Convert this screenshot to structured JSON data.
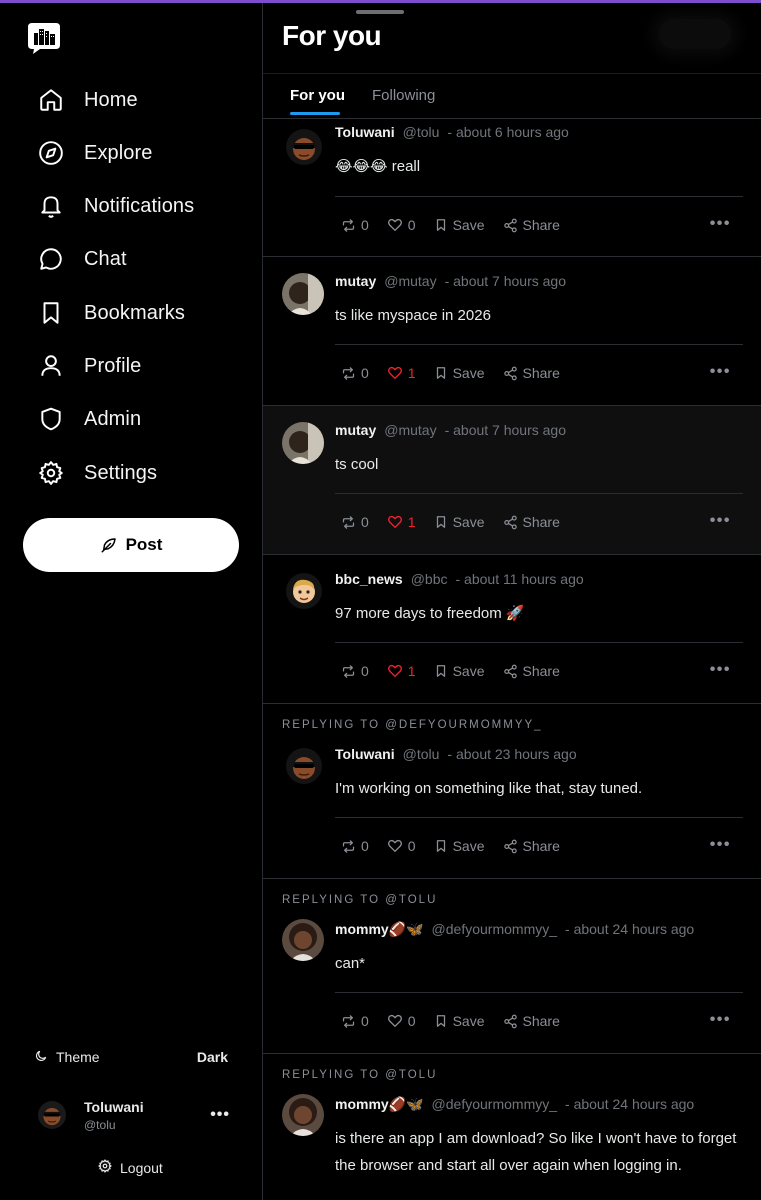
{
  "sidebar": {
    "nav": [
      {
        "label": "Home",
        "icon": "home-icon"
      },
      {
        "label": "Explore",
        "icon": "compass-icon"
      },
      {
        "label": "Notifications",
        "icon": "bell-icon"
      },
      {
        "label": "Chat",
        "icon": "chat-bubble-icon"
      },
      {
        "label": "Bookmarks",
        "icon": "bookmark-icon"
      },
      {
        "label": "Profile",
        "icon": "user-icon"
      },
      {
        "label": "Admin",
        "icon": "shield-icon"
      },
      {
        "label": "Settings",
        "icon": "gear-icon"
      }
    ],
    "post_label": "Post",
    "theme_label": "Theme",
    "theme_value": "Dark",
    "user": {
      "name": "Toluwani",
      "handle": "@tolu"
    },
    "logout_label": "Logout"
  },
  "header": {
    "title": "For you"
  },
  "tabs": [
    {
      "label": "For you",
      "active": true
    },
    {
      "label": "Following",
      "active": false
    }
  ],
  "colors": {
    "accent": "#1d9bf0",
    "like": "#f4212e",
    "top_bar": "#7c4dcc"
  },
  "posts": [
    {
      "name": "Toluwani",
      "handle": "@tolu",
      "time": "- about 6 hours ago",
      "body": "😂😂😂 reall",
      "reposts": "0",
      "likes": "0",
      "liked": false
    },
    {
      "name": "mutay",
      "handle": "@mutay",
      "time": "- about 7 hours ago",
      "body": "ts like myspace in 2026",
      "reposts": "0",
      "likes": "1",
      "liked": true
    },
    {
      "name": "mutay",
      "handle": "@mutay",
      "time": "- about 7 hours ago",
      "body": "ts cool",
      "reposts": "0",
      "likes": "1",
      "liked": true
    },
    {
      "name": "bbc_news",
      "handle": "@bbc",
      "time": "- about 11 hours ago",
      "body": "97 more days to freedom 🚀",
      "reposts": "0",
      "likes": "1",
      "liked": true
    },
    {
      "reply_to": "Replying to @defyourmommyy_",
      "name": "Toluwani",
      "handle": "@tolu",
      "time": "- about 23 hours ago",
      "body": "I'm working on something like that, stay tuned.",
      "reposts": "0",
      "likes": "0",
      "liked": false
    },
    {
      "reply_to": "Replying to @tolu",
      "name": "mommy🏈🦋",
      "handle": "@defyourmommyy_",
      "time": "- about 24 hours ago",
      "body": "can*",
      "reposts": "0",
      "likes": "0",
      "liked": false
    },
    {
      "reply_to": "Replying to @tolu",
      "name": "mommy🏈🦋",
      "handle": "@defyourmommyy_",
      "time": "- about 24 hours ago",
      "body": "is there an app I am download? So like I won't have to forget the browser and start all over again when logging in.",
      "reposts": "",
      "likes": "",
      "liked": false
    }
  ],
  "actions": {
    "save_label": "Save",
    "share_label": "Share"
  }
}
